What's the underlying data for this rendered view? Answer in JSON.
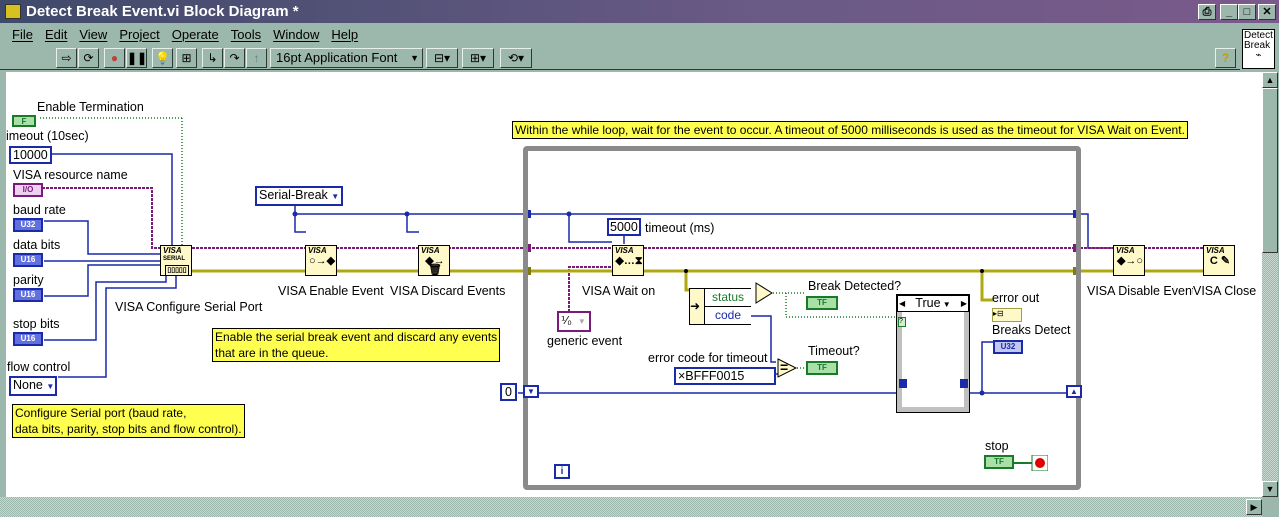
{
  "window": {
    "title": "Detect Break Event.vi Block Diagram *",
    "controls": [
      "print",
      "minimize",
      "maximize",
      "close"
    ]
  },
  "menu": [
    "File",
    "Edit",
    "View",
    "Project",
    "Operate",
    "Tools",
    "Window",
    "Help"
  ],
  "toolbar": {
    "font": "16pt Application Font",
    "help": "?"
  },
  "vi_icon": {
    "line1": "Detect",
    "line2": "Break"
  },
  "diagram": {
    "enable_termination": {
      "label": "Enable Termination",
      "value": "F"
    },
    "timeout_const": {
      "label": "imeout (10sec)",
      "value": "10000"
    },
    "resource_name": {
      "label": "VISA resource name",
      "value": "I/O"
    },
    "baud_rate": {
      "label": "baud rate",
      "type": "U32"
    },
    "data_bits": {
      "label": "data bits",
      "type": "U16"
    },
    "parity": {
      "label": "parity",
      "type": "U16"
    },
    "stop_bits": {
      "label": "stop bits",
      "type": "U16"
    },
    "flow_control": {
      "label": "flow control",
      "value": "None"
    },
    "configure_node": {
      "label": "VISA Configure Serial Port",
      "icon_text": "VISA",
      "sub": "SERIAL"
    },
    "comment_configure": [
      "Configure Serial port (baud rate,",
      "data bits, parity, stop bits and flow control)."
    ],
    "event_type": "Serial-Break",
    "enable_node": {
      "label": "VISA Enable Event",
      "icon_text": "VISA"
    },
    "discard_node": {
      "label": "VISA Discard Events",
      "icon_text": "VISA"
    },
    "comment_enable": [
      "Enable the serial break event and discard any events",
      "that are in the queue."
    ],
    "comment_loop": "Within the while loop, wait for the event to occur.  A timeout of 5000 milliseconds is used as the timeout for VISA Wait on Event.",
    "wait_timeout": {
      "value": "5000",
      "label": "timeout (ms)"
    },
    "wait_node": {
      "label": "VISA Wait on",
      "icon_text": "VISA"
    },
    "generic_event": {
      "label": "generic event"
    },
    "unbundle": {
      "status": "status",
      "code": "code"
    },
    "break_detected": {
      "label": "Break Detected?",
      "type": "TF"
    },
    "timeout_indicator": {
      "label": "Timeout?",
      "type": "TF"
    },
    "error_code_timeout": {
      "label": "error code for timeout",
      "value": "×BFFF0015"
    },
    "case_structure": {
      "selector": "True"
    },
    "increment": "+1",
    "error_out": {
      "label": "error out"
    },
    "breaks_detected": {
      "label": "Breaks Detect",
      "type": "U32"
    },
    "shift_register_init": "0",
    "stop": {
      "label": "stop",
      "type": "TF"
    },
    "iteration": "i",
    "disable_node": {
      "label": "VISA Disable Event",
      "icon_text": "VISA"
    },
    "close_node": {
      "label": "VISA Close",
      "icon_text": "VISA"
    }
  },
  "colors": {
    "refnum_wire": "#7a1a7a",
    "error_wire": "#c8c020",
    "numeric_wire": "#1a2aa8",
    "boolean_wire": "#1a7a2a",
    "comment_bg": "#ffff50"
  }
}
